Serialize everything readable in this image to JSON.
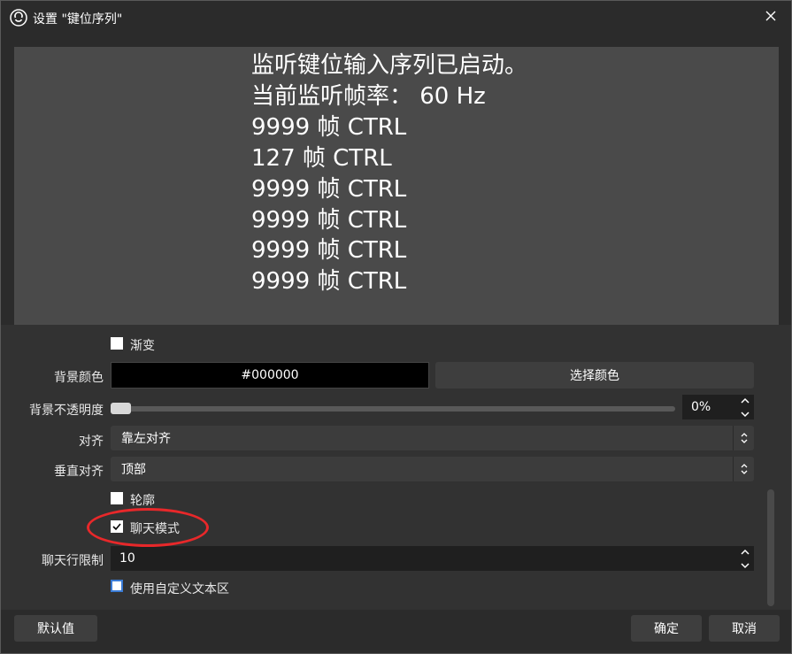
{
  "window": {
    "title": "设置 \"键位序列\"",
    "icon": "obs-logo-icon",
    "close_icon": "close-icon"
  },
  "preview": {
    "lines": [
      "监听键位输入序列已启动。",
      "当前监听帧率：  60 Hz",
      "9999 帧  CTRL",
      "127 帧  CTRL",
      "9999 帧  CTRL",
      "9999 帧  CTRL",
      "9999 帧  CTRL",
      "9999 帧  CTRL"
    ]
  },
  "properties": {
    "gradient": {
      "label": "渐变",
      "checked": false
    },
    "bg_color": {
      "label": "背景颜色",
      "value": "#000000",
      "button": "选择颜色"
    },
    "bg_opacity": {
      "label": "背景不透明度",
      "value": "0%",
      "level": 0
    },
    "align": {
      "label": "对齐",
      "value": "靠左对齐"
    },
    "valign": {
      "label": "垂直对齐",
      "value": "顶部"
    },
    "outline": {
      "label": "轮廓",
      "checked": false
    },
    "chat_mode": {
      "label": "聊天模式",
      "checked": true
    },
    "chat_limit": {
      "label": "聊天行限制",
      "value": "10"
    },
    "custom_text_area": {
      "label": "使用自定义文本区",
      "checked": false
    }
  },
  "footer": {
    "defaults": "默认值",
    "ok": "确定",
    "cancel": "取消"
  },
  "colors": {
    "background": "#2b2b2b",
    "panel": "#323232",
    "preview_bg": "#4a4a4a",
    "button": "#3e3e3e",
    "annotation": "#e8282a"
  }
}
